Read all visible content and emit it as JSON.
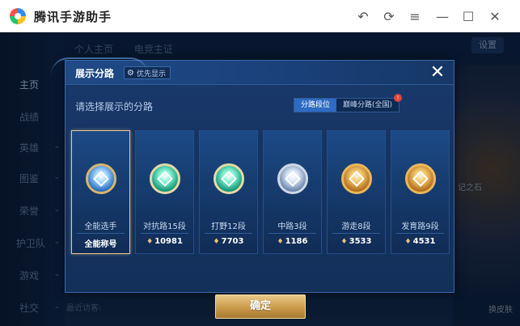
{
  "window": {
    "app_title": "腾讯手游助手",
    "icons": [
      "undo-icon",
      "refresh-icon",
      "menu-icon",
      "minimize-icon",
      "maximize-icon",
      "close-icon"
    ]
  },
  "background": {
    "top_tabs": [
      "个人主页",
      "电竞主证"
    ],
    "settings_label": "设置",
    "left_nav": [
      {
        "label": "主页",
        "has_chevron": false
      },
      {
        "label": "战绩",
        "has_chevron": false
      },
      {
        "label": "英雄",
        "has_chevron": true
      },
      {
        "label": "图鉴",
        "has_chevron": true
      },
      {
        "label": "荣誉",
        "has_chevron": true
      },
      {
        "label": "护卫队",
        "has_chevron": true
      },
      {
        "label": "游戏",
        "has_chevron": true
      },
      {
        "label": "社交",
        "has_chevron": true
      }
    ],
    "bottom_text": "最近访客:",
    "right_side_labels": [
      "记之石",
      "换皮肤"
    ]
  },
  "modal": {
    "title": "展示分路",
    "priority_chip": "优先显示",
    "subtitle": "请选择展示的分路",
    "segments": [
      "分路段位",
      "巅峰分路(全国)"
    ],
    "active_segment": 0,
    "cards": [
      {
        "name": "全能选手",
        "stat": "全能称号",
        "stat_icon": false,
        "emblem": "default",
        "selected": true
      },
      {
        "name": "对抗路15段",
        "stat": "10981",
        "stat_icon": true,
        "emblem": "teal",
        "selected": false
      },
      {
        "name": "打野12段",
        "stat": "7703",
        "stat_icon": true,
        "emblem": "teal",
        "selected": false
      },
      {
        "name": "中路3段",
        "stat": "1186",
        "stat_icon": true,
        "emblem": "silver",
        "selected": false
      },
      {
        "name": "游走8段",
        "stat": "3533",
        "stat_icon": true,
        "emblem": "gold",
        "selected": false
      },
      {
        "name": "发育路9段",
        "stat": "4531",
        "stat_icon": true,
        "emblem": "gold",
        "selected": false
      }
    ],
    "confirm_label": "确定",
    "colors": {
      "accent_gold": "#d9b56a",
      "active_segment": "#2d6bc4",
      "panel": "#163361"
    }
  }
}
